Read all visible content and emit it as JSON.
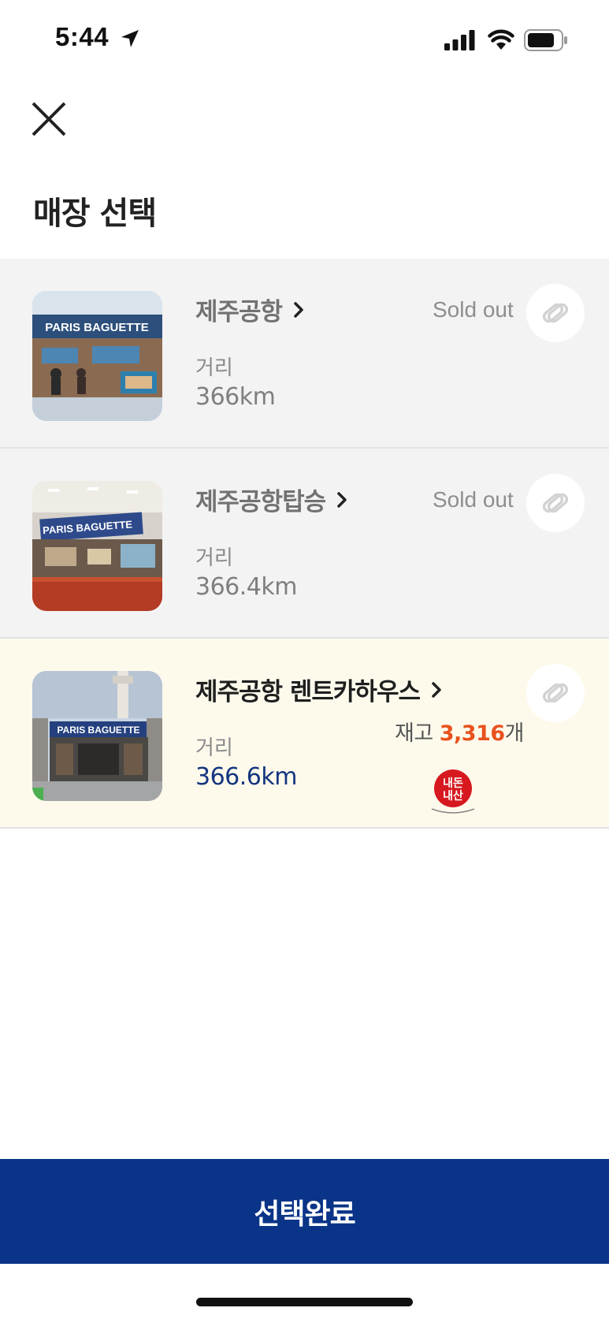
{
  "status_bar": {
    "time": "5:44"
  },
  "header": {
    "title": "매장 선택"
  },
  "stores": [
    {
      "name": "제주공항",
      "distance_label": "거리",
      "distance": "366km",
      "status": "Sold out"
    },
    {
      "name": "제주공항탑승",
      "distance_label": "거리",
      "distance": "366.4km",
      "status": "Sold out"
    },
    {
      "name": "제주공항 렌트카하우스",
      "distance_label": "거리",
      "distance": "366.6km",
      "stock_prefix": "재고 ",
      "stock_count": "3,316",
      "stock_suffix": "개",
      "badge_line1": "내돈",
      "badge_line2": "내산"
    }
  ],
  "footer": {
    "confirm_label": "선택완료"
  },
  "colors": {
    "primary": "#0a3487",
    "distance_active": "#14357f",
    "stock_highlight": "#e8521e",
    "selected_bg": "#fdfaec",
    "soldout_bg": "#f3f3f3",
    "badge_red": "#d7181f"
  },
  "icons": [
    "location-arrow-icon",
    "signal-icon",
    "wifi-icon",
    "battery-icon",
    "close-icon",
    "chevron-right-icon",
    "favorite-link-icon"
  ]
}
